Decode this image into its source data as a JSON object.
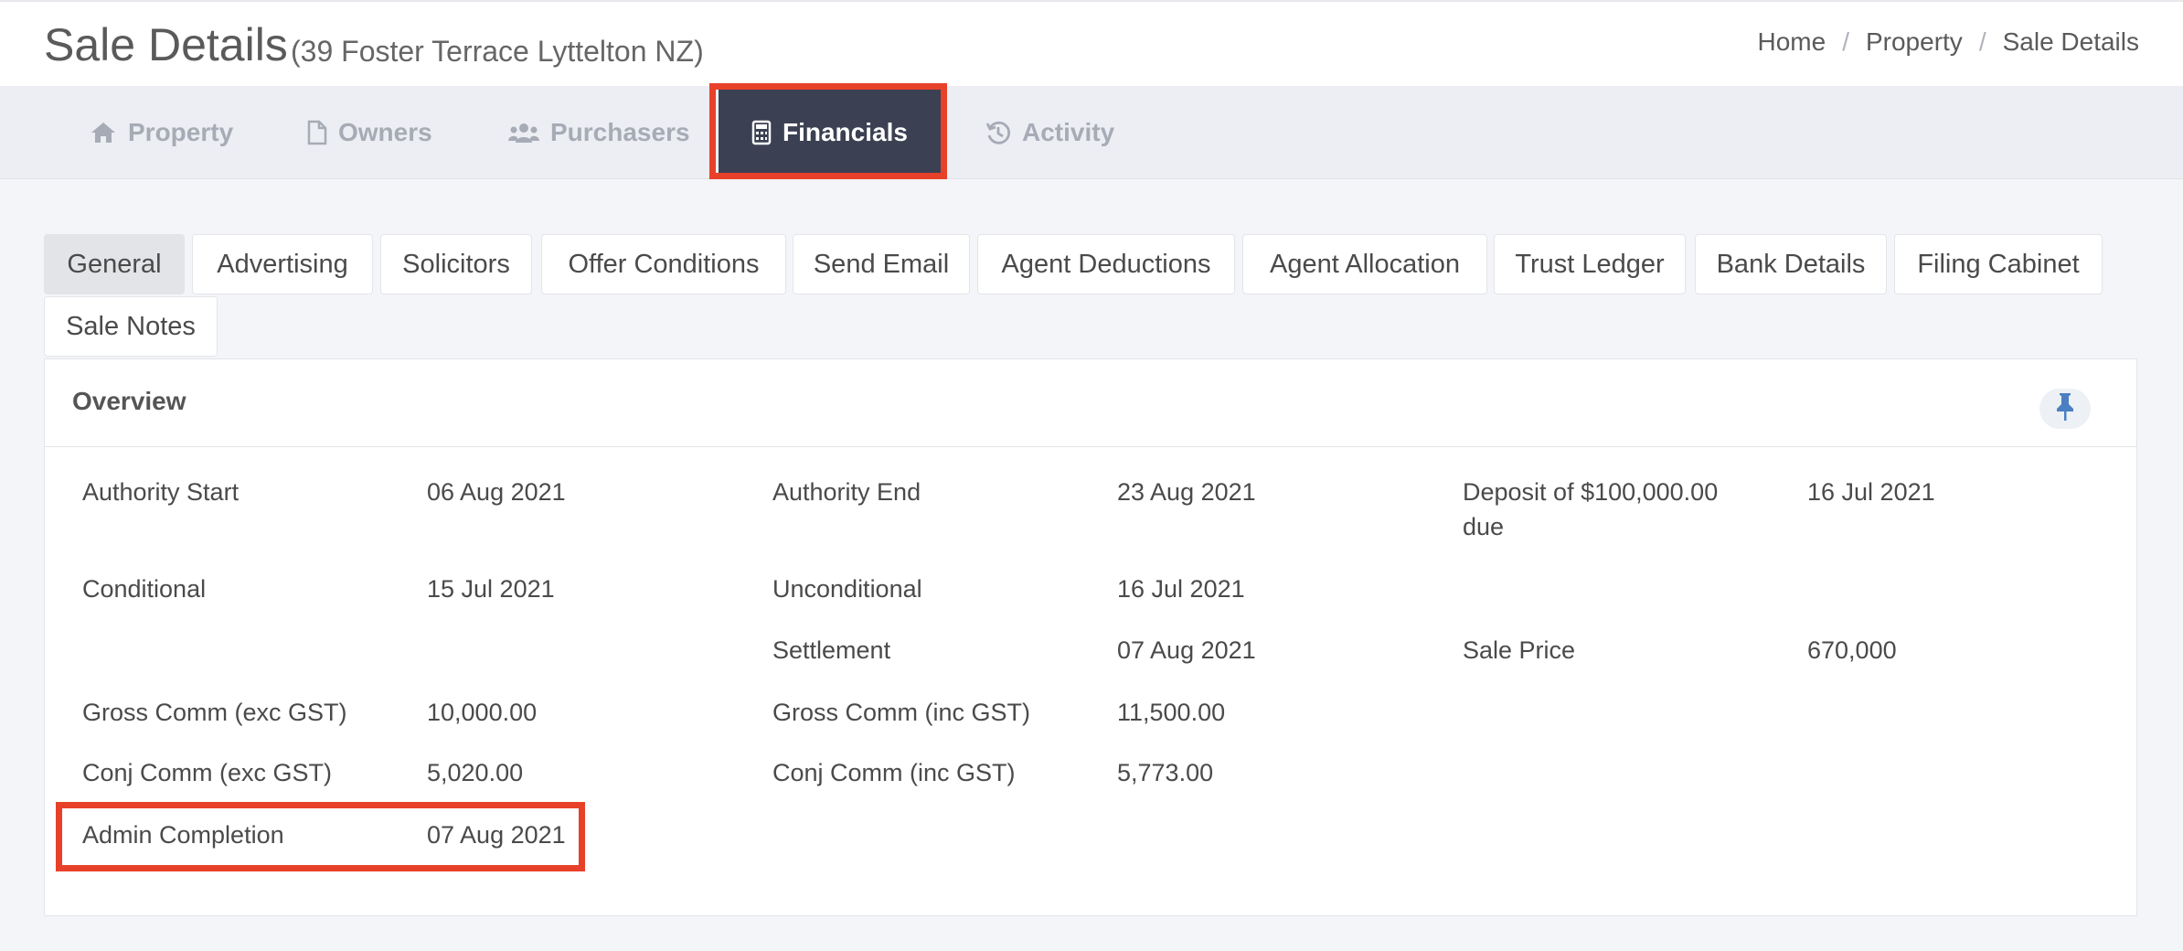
{
  "header": {
    "title": "Sale Details",
    "subtitle": "(39 Foster Terrace Lyttelton NZ)",
    "breadcrumb": [
      "Home",
      "Property",
      "Sale Details"
    ],
    "breadcrumb_separator": "/"
  },
  "top_tabs": [
    {
      "label": "Property",
      "icon": "home-icon"
    },
    {
      "label": "Owners",
      "icon": "file-icon"
    },
    {
      "label": "Purchasers",
      "icon": "users-icon"
    },
    {
      "label": "Financials",
      "icon": "calculator-icon",
      "active": true
    },
    {
      "label": "Activity",
      "icon": "history-icon"
    }
  ],
  "sub_tabs": [
    {
      "label": "General",
      "active": true
    },
    {
      "label": "Advertising"
    },
    {
      "label": "Solicitors"
    },
    {
      "label": "Offer Conditions"
    },
    {
      "label": "Send Email"
    },
    {
      "label": "Agent Deductions"
    },
    {
      "label": "Agent Allocation"
    },
    {
      "label": "Trust Ledger"
    },
    {
      "label": "Bank Details"
    },
    {
      "label": "Filing Cabinet"
    },
    {
      "label": "Sale Notes"
    }
  ],
  "overview": {
    "title": "Overview",
    "pin_icon": "pin-icon",
    "fields": {
      "authority_start": {
        "label": "Authority Start",
        "value": "06 Aug 2021"
      },
      "authority_end": {
        "label": "Authority End",
        "value": "23 Aug 2021"
      },
      "deposit": {
        "label": "Deposit of $100,000.00 due",
        "value": "16 Jul 2021"
      },
      "conditional": {
        "label": "Conditional",
        "value": "15 Jul 2021"
      },
      "unconditional": {
        "label": "Unconditional",
        "value": "16 Jul 2021"
      },
      "settlement": {
        "label": "Settlement",
        "value": "07 Aug 2021"
      },
      "sale_price": {
        "label": "Sale Price",
        "value": "670,000"
      },
      "gross_comm_exc": {
        "label": "Gross Comm (exc GST)",
        "value": "10,000.00"
      },
      "gross_comm_inc": {
        "label": "Gross Comm (inc GST)",
        "value": "11,500.00"
      },
      "conj_comm_exc": {
        "label": "Conj Comm (exc GST)",
        "value": "5,020.00"
      },
      "conj_comm_inc": {
        "label": "Conj Comm (inc GST)",
        "value": "5,773.00"
      },
      "admin_completion": {
        "label": "Admin Completion",
        "value": "07 Aug 2021"
      }
    }
  },
  "colors": {
    "active_tab_bg": "#3b4152",
    "highlight": "#e8412a",
    "tab_inactive_text": "#a6abb6",
    "pin_blue": "#4a7fc1"
  }
}
